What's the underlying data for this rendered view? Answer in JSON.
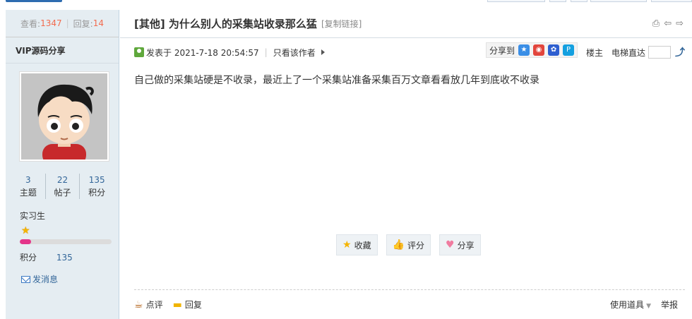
{
  "stats": {
    "views_label": "查看:",
    "views": "1347",
    "replies_label": "回复:",
    "replies": "14"
  },
  "author": {
    "name": "VIP源码分享",
    "counts": [
      {
        "n": "3",
        "l": "主题"
      },
      {
        "n": "22",
        "l": "帖子"
      },
      {
        "n": "135",
        "l": "积分"
      }
    ],
    "rank": "实习生",
    "progress_fraction": 0.12,
    "credit_label": "积分",
    "credit_value": "135",
    "pm_label": "发消息"
  },
  "post": {
    "title": "[其他] 为什么别人的采集站收录那么猛",
    "copy_link": "[复制链接]",
    "posted": "发表于 2021-7-18 20:54:57",
    "only_author": "只看该作者",
    "share_label": "分享到",
    "floor": "楼主",
    "elevator": "电梯直达",
    "content": "自己做的采集站硬是不收录，最近上了一个采集站准备采集百万文章看看放几年到底收不收录",
    "actions": {
      "favorite": "收藏",
      "rate": "评分",
      "share": "分享"
    },
    "footer": {
      "comment": "点评",
      "reply": "回复",
      "tools": "使用道具",
      "report": "举报"
    }
  },
  "colors": {
    "accent": "#336699",
    "count_red": "#f26c4f",
    "progress": "#e4358a",
    "sidebar_bg": "#e5edf2"
  }
}
